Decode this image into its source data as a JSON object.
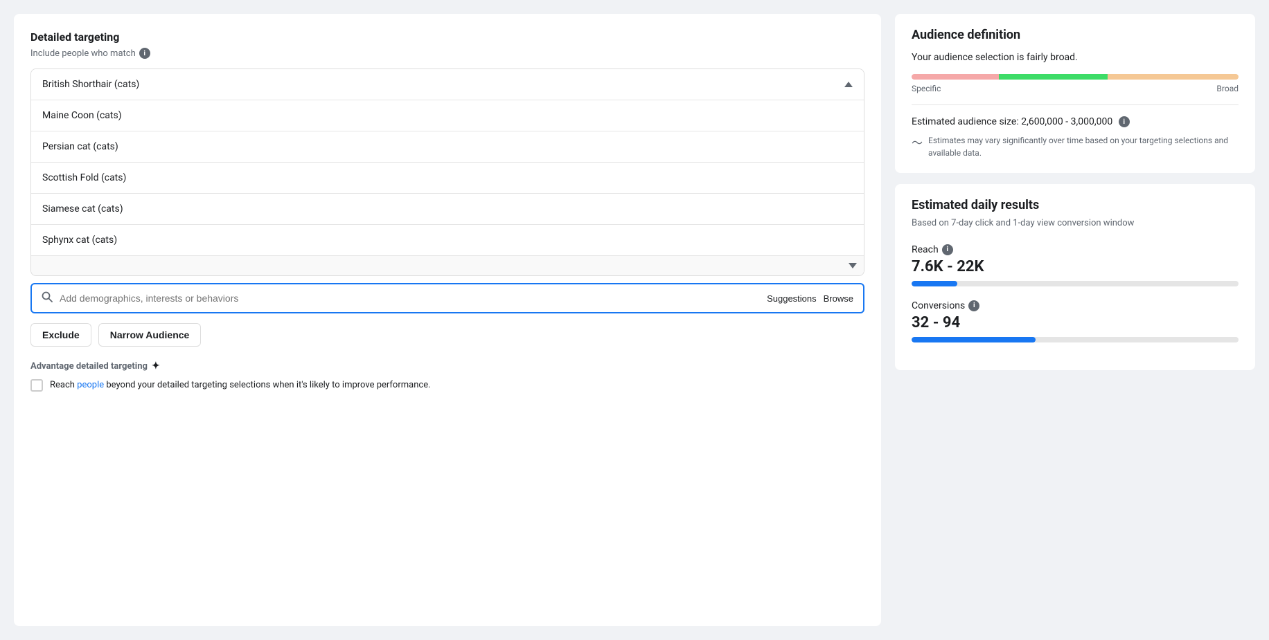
{
  "left": {
    "section_title": "Detailed targeting",
    "subtitle": "Include people who match",
    "list_items": [
      "British Shorthair (cats)",
      "Maine Coon (cats)",
      "Persian cat (cats)",
      "Scottish Fold (cats)",
      "Siamese cat (cats)",
      "Sphynx cat (cats)"
    ],
    "search_placeholder": "Add demographics, interests or behaviors",
    "search_suggestions_label": "Suggestions",
    "search_browse_label": "Browse",
    "exclude_button": "Exclude",
    "narrow_audience_button": "Narrow Audience",
    "advantage_title": "Advantage detailed targeting",
    "advantage_description_pre": "Reach ",
    "advantage_link": "people",
    "advantage_description_post": " beyond your detailed targeting selections when it's likely to improve performance."
  },
  "right": {
    "audience_definition": {
      "title": "Audience definition",
      "description": "Your audience selection is fairly broad.",
      "gauge_label_specific": "Specific",
      "gauge_label_broad": "Broad",
      "audience_size_label": "Estimated audience size: 2,600,000 - 3,000,000",
      "estimate_note": "Estimates may vary significantly over time based on your targeting selections and available data."
    },
    "daily_results": {
      "title": "Estimated daily results",
      "subtitle": "Based on 7-day click and 1-day view conversion window",
      "reach_label": "Reach",
      "reach_value": "7.6K - 22K",
      "conversions_label": "Conversions",
      "conversions_value": "32 - 94"
    }
  }
}
